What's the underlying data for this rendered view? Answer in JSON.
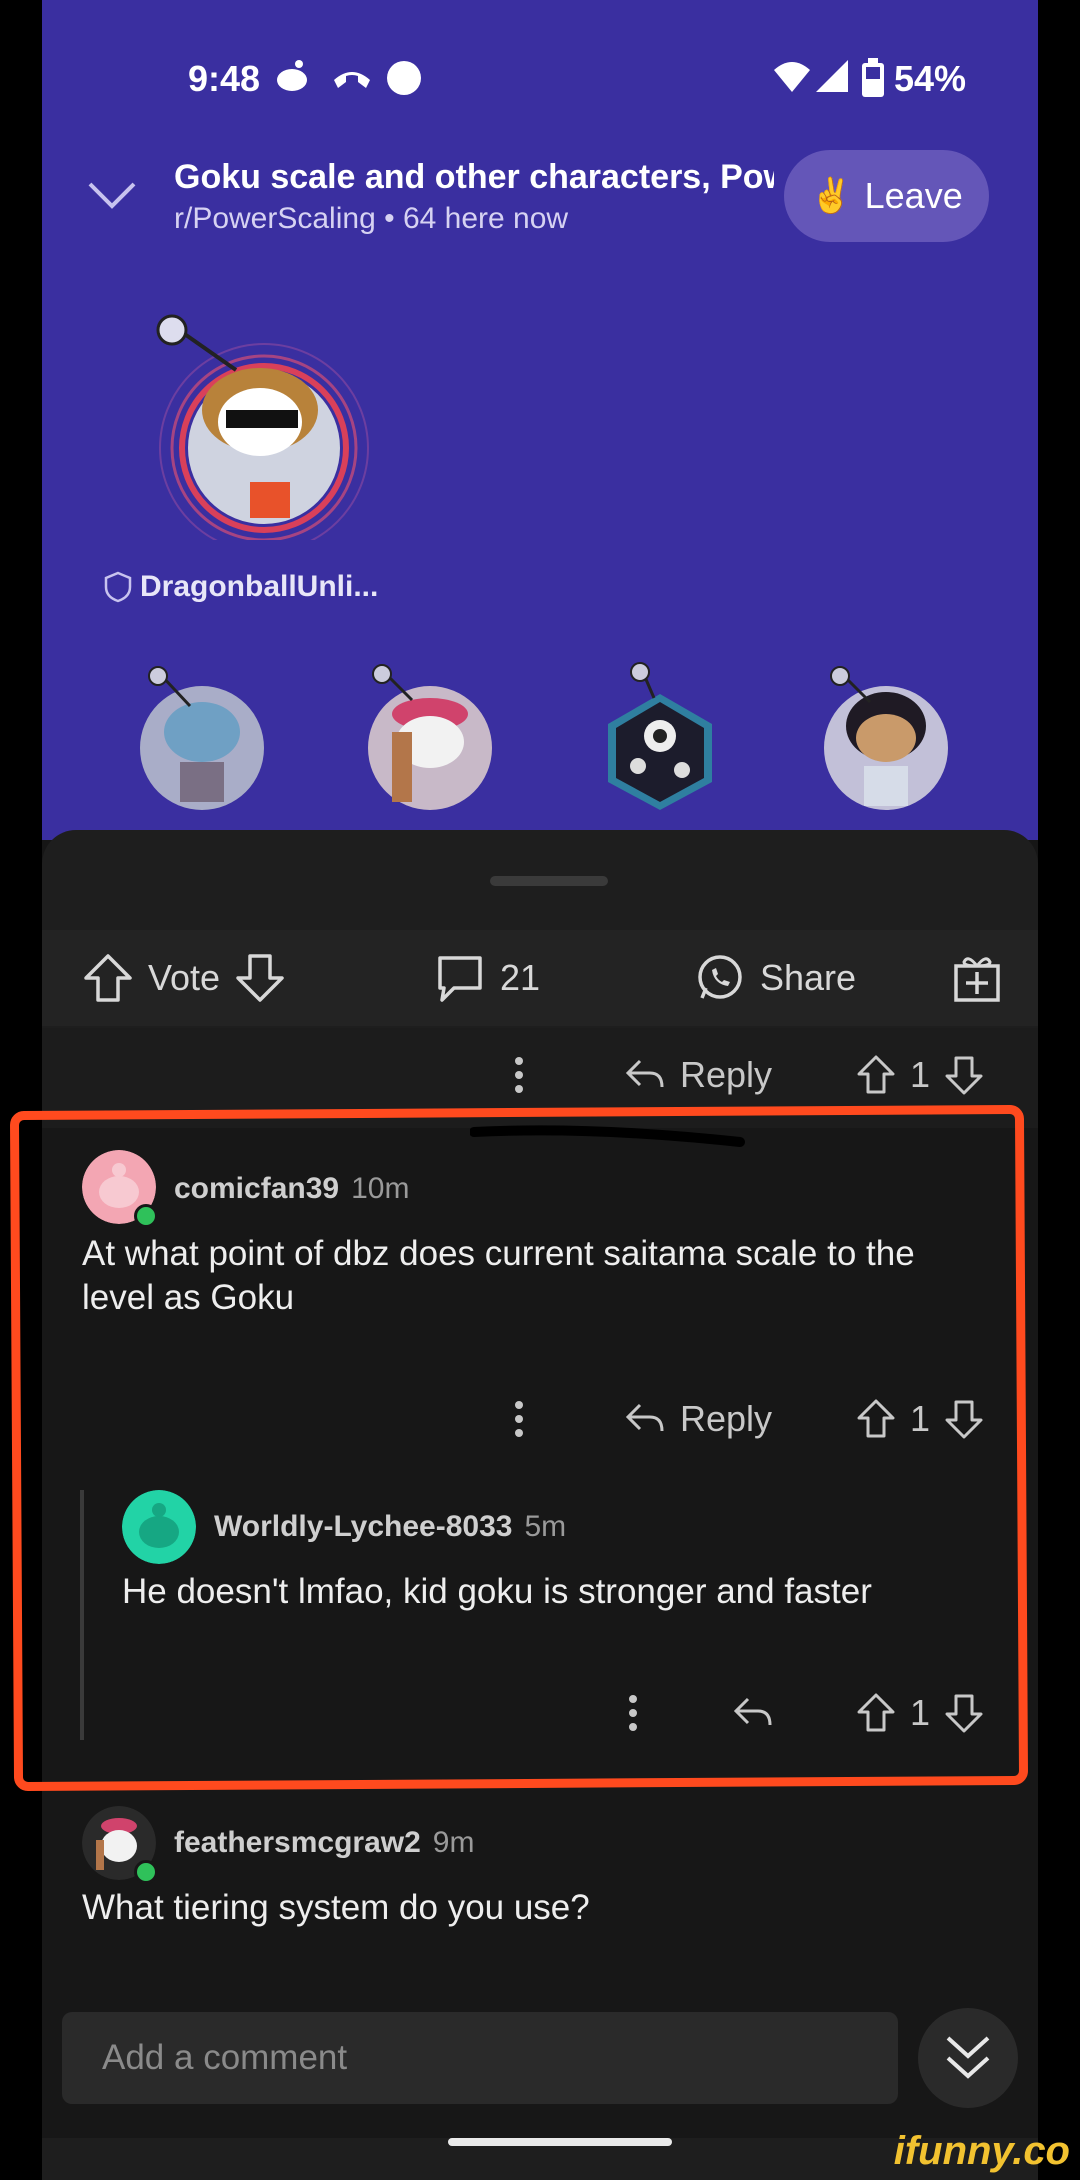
{
  "status": {
    "time": "9:48",
    "battery": "54%"
  },
  "header": {
    "title": "Goku scale and other characters, Pow",
    "subreddit": "r/PowerScaling",
    "presence": "64 here now",
    "leave_label": "Leave"
  },
  "stage": {
    "host_name": "DragonballUnli..."
  },
  "actions": {
    "vote_label": "Vote",
    "comment_count": "21",
    "share_label": "Share"
  },
  "prev_comment": {
    "reply_label": "Reply",
    "score": "1"
  },
  "comments": [
    {
      "user": "comicfan39",
      "time": "10m",
      "text_line1": "At what point of dbz does current saitama scale to the",
      "text_line2": "level as Goku",
      "reply_label": "Reply",
      "score": "1"
    },
    {
      "user": "Worldly-Lychee-8033",
      "time": "5m",
      "text": "He doesn't lmfao, kid goku is stronger and faster",
      "score": "1"
    },
    {
      "user": "feathersmcgraw2",
      "time": "9m",
      "text": "What tiering system do you use?"
    }
  ],
  "composer": {
    "placeholder": "Add a comment"
  },
  "watermark": "ifunny.co",
  "colors": {
    "header_bg": "#3a2fa0",
    "sheet_bg": "#1e1e1e",
    "annotation": "#ff4a1e",
    "online": "#2fc15a"
  }
}
